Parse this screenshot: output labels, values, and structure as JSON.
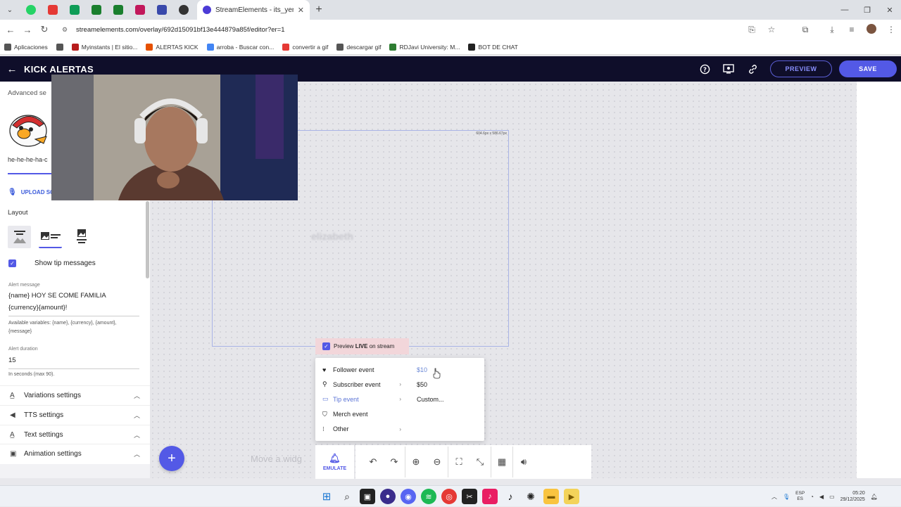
{
  "browser": {
    "tab_title": "StreamElements - its_yero",
    "url": "streamelements.com/overlay/692d15091bf13e444879a85f/editor?er=1",
    "bookmarks": [
      {
        "label": "Aplicaciones",
        "color": "#555555"
      },
      {
        "label": "",
        "color": "#555555"
      },
      {
        "label": "Myinstants | El sitio...",
        "color": "#b71c1c"
      },
      {
        "label": "ALERTAS KICK",
        "color": "#e65100"
      },
      {
        "label": "arroba - Buscar con...",
        "color": "#4285f4"
      },
      {
        "label": "convertir a gif",
        "color": "#e53935"
      },
      {
        "label": "descargar gif",
        "color": "#555555"
      },
      {
        "label": "RDJavi University: M...",
        "color": "#2e7d32"
      },
      {
        "label": "BOT DE CHAT",
        "color": "#222222"
      }
    ]
  },
  "header": {
    "title": "KICK ALERTAS",
    "preview_label": "PREVIEW",
    "save_label": "SAVE"
  },
  "left_panel": {
    "advanced_label": "Advanced se",
    "sound_file": "he-he-he-ha-c",
    "upload_label": "UPLOAD SO",
    "layout_label": "Layout",
    "show_tip_messages": "Show tip messages",
    "alert_message_label": "Alert message",
    "alert_message_line1": "{name} HOY SE COME FAMILIA",
    "alert_message_line2": "{currency}{amount}!",
    "available_vars_line1": "Available variables: {name}, {currency}, {amount},",
    "available_vars_line2": "{message}",
    "alert_duration_label": "Alert duration",
    "alert_duration_value": "15",
    "alert_duration_help": "In seconds (max 90).",
    "sections": [
      {
        "label": "Variations settings"
      },
      {
        "label": "TTS settings"
      },
      {
        "label": "Text settings"
      },
      {
        "label": "Animation settings"
      }
    ]
  },
  "canvas": {
    "widget_dimensions": "604.6px x 586.67px",
    "widget_preview_name": "elizabeth",
    "preview_live_pre": "Preview",
    "preview_live_bold": "LIVE",
    "preview_live_post": "on stream",
    "hint": "Move a widg"
  },
  "emulate_menu": {
    "items": [
      {
        "label": "Follower event",
        "icon": "heart-icon"
      },
      {
        "label": "Subscriber event",
        "icon": "star-user-icon"
      },
      {
        "label": "Tip event",
        "icon": "card-icon"
      },
      {
        "label": "Merch event",
        "icon": "shirt-icon"
      },
      {
        "label": "Other",
        "icon": "dots-icon"
      }
    ],
    "tip_options": [
      "$10",
      "$50",
      "Custom..."
    ]
  },
  "toolbar": {
    "emulate_label": "EMULATE"
  },
  "taskbar": {
    "lang_top": "ESP",
    "lang_bottom": "ES",
    "time": "05:20",
    "date": "29/12/2025"
  }
}
